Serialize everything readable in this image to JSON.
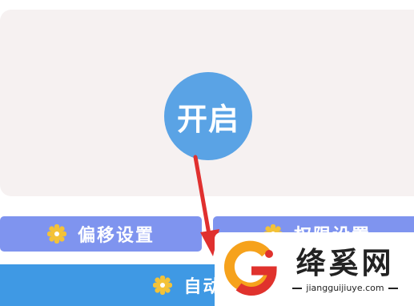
{
  "main": {
    "start_label": "开启"
  },
  "buttons": {
    "offset": {
      "label": "偏移设置",
      "icon": "gear-icon"
    },
    "permission": {
      "label": "权限设置",
      "icon": "gear-icon"
    },
    "auto": {
      "label": "自动点击",
      "icon": "gear-icon"
    }
  },
  "watermark": {
    "brand": "绛奚网",
    "domain": "jiangguijiuye.com",
    "logo": "g-logo"
  },
  "colors": {
    "panel_background": "#f6f1f1",
    "start_circle": "#5aa3e5",
    "setting_button": "#7f94ef",
    "auto_button": "#3f99e4",
    "icon_yellow": "#f3c238",
    "arrow_red": "#e0302f",
    "logo_orange": "#f6a21c",
    "logo_red": "#e0322d"
  }
}
